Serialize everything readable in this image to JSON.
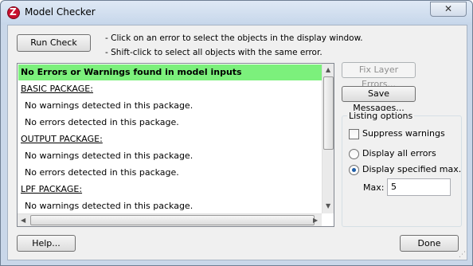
{
  "window": {
    "title": "Model Checker",
    "close_glyph": "✕"
  },
  "toolbar": {
    "run_check_label": "Run Check",
    "hint_line1": "- Click on an error to select the objects in the display window.",
    "hint_line2": "- Shift-click to select all objects with the same error."
  },
  "messages": [
    {
      "text": "No Errors or Warnings found in model inputs",
      "kind": "ok"
    },
    {
      "text": "BASIC PACKAGE:",
      "kind": "pkg"
    },
    {
      "text": "No warnings detected in this package.",
      "kind": "msg"
    },
    {
      "text": "No errors detected in this package.",
      "kind": "msg"
    },
    {
      "text": "OUTPUT PACKAGE:",
      "kind": "pkg"
    },
    {
      "text": "No warnings detected in this package.",
      "kind": "msg"
    },
    {
      "text": "No errors detected in this package.",
      "kind": "msg"
    },
    {
      "text": "LPF PACKAGE:",
      "kind": "pkg"
    },
    {
      "text": "No warnings detected in this package.",
      "kind": "msg"
    }
  ],
  "side": {
    "fix_layer_errors_label": "Fix Layer Errors...",
    "save_messages_label": "Save Messages..."
  },
  "listing_options": {
    "group_label": "Listing options",
    "suppress_warnings_label": "Suppress warnings",
    "suppress_warnings_checked": false,
    "display_all_errors_label": "Display all errors",
    "display_specified_max_label": "Display specified max.",
    "selected_mode": "Display specified max.",
    "max_label": "Max:",
    "max_value": "5"
  },
  "footer": {
    "help_label": "Help...",
    "done_label": "Done"
  },
  "colors": {
    "ok_highlight": "#7cf07c",
    "radio_dot": "#1e5ea8",
    "brand_icon": "#c8102e"
  },
  "icons": {
    "app": "app-logo-icon",
    "scroll_up": "scroll-up-arrow-icon",
    "scroll_down": "scroll-down-arrow-icon"
  }
}
